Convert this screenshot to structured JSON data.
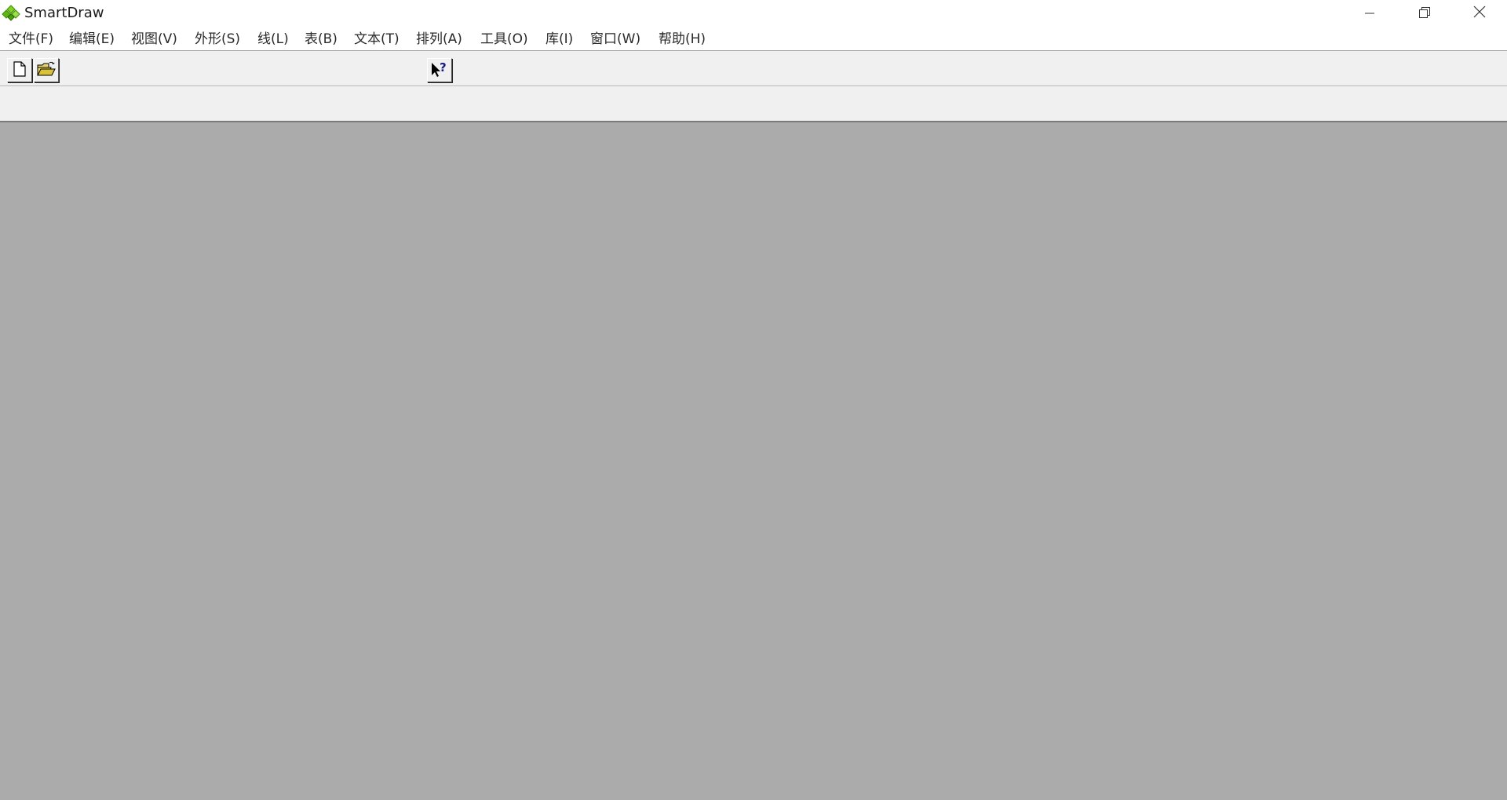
{
  "window": {
    "title": "SmartDraw",
    "controls": {
      "minimize_icon": "minimize-icon",
      "restore_icon": "restore-icon",
      "close_icon": "close-icon"
    }
  },
  "menubar": {
    "items": [
      {
        "label": "文件(F)"
      },
      {
        "label": "编辑(E)"
      },
      {
        "label": "视图(V)"
      },
      {
        "label": "外形(S)"
      },
      {
        "label": "线(L)"
      },
      {
        "label": "表(B)"
      },
      {
        "label": "文本(T)"
      },
      {
        "label": "排列(A)"
      },
      {
        "label": "工具(O)"
      },
      {
        "label": "库(I)"
      },
      {
        "label": "窗口(W)"
      },
      {
        "label": "帮助(H)"
      }
    ]
  },
  "toolbar": {
    "buttons": [
      {
        "icon": "new-document-icon"
      },
      {
        "icon": "open-folder-icon"
      },
      {
        "icon": "context-help-icon"
      }
    ]
  },
  "colors": {
    "workspace": "#ababab",
    "toolbar": "#f0f0f0",
    "logo_green": "#6cc414"
  }
}
